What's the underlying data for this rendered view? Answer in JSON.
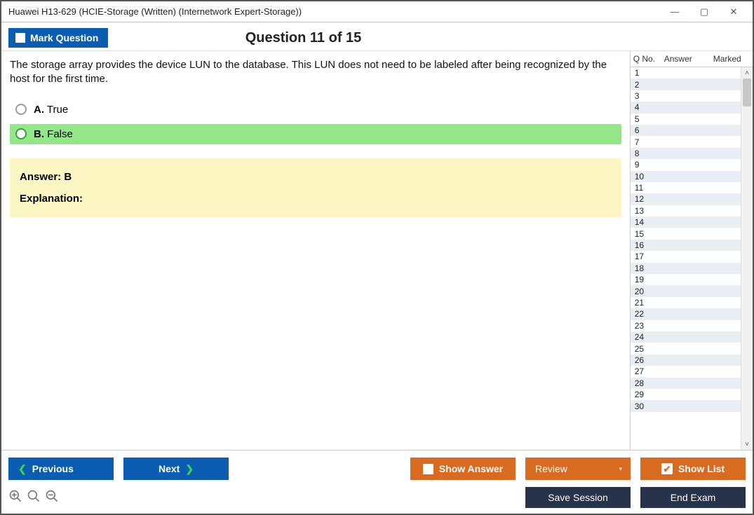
{
  "window": {
    "title": "Huawei H13-629 (HCIE-Storage (Written) (Internetwork Expert-Storage))"
  },
  "header": {
    "mark_label": "Mark Question",
    "counter": "Question 11 of 15"
  },
  "question": {
    "text": "The storage array provides the device LUN to the database. This LUN does not need to be labeled after being recognized by the host for the first time.",
    "options": [
      {
        "letter": "A.",
        "label": "True",
        "selected": false
      },
      {
        "letter": "B.",
        "label": "False",
        "selected": true
      }
    ],
    "answer_line": "Answer: B",
    "explanation_label": "Explanation:"
  },
  "sidebar": {
    "columns": {
      "qno": "Q No.",
      "answer": "Answer",
      "marked": "Marked"
    },
    "rows": [
      1,
      2,
      3,
      4,
      5,
      6,
      7,
      8,
      9,
      10,
      11,
      12,
      13,
      14,
      15,
      16,
      17,
      18,
      19,
      20,
      21,
      22,
      23,
      24,
      25,
      26,
      27,
      28,
      29,
      30
    ]
  },
  "footer": {
    "previous": "Previous",
    "next": "Next",
    "show_answer": "Show Answer",
    "review": "Review",
    "show_list": "Show List",
    "save_session": "Save Session",
    "end_exam": "End Exam"
  }
}
